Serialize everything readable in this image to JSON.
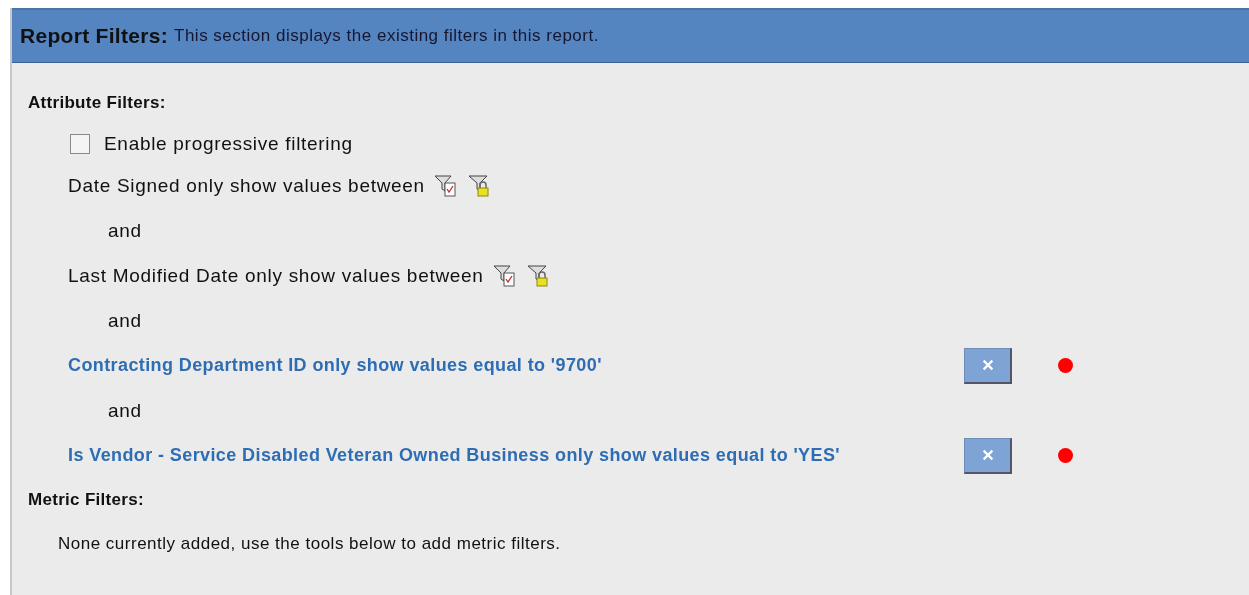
{
  "header": {
    "title": "Report Filters:",
    "description": "This section displays the existing filters in this report."
  },
  "attribute_filters": {
    "heading": "Attribute Filters:",
    "progressive": {
      "label": "Enable progressive filtering",
      "checked": false
    },
    "items": [
      {
        "kind": "range",
        "text": "Date Signed only show values between"
      },
      {
        "kind": "conjunction",
        "text": "and"
      },
      {
        "kind": "range",
        "text": "Last Modified Date only show values between"
      },
      {
        "kind": "conjunction",
        "text": "and"
      },
      {
        "kind": "equal",
        "text": "Contracting Department ID only show values equal to '9700'",
        "color": "#ff0000"
      },
      {
        "kind": "conjunction",
        "text": "and"
      },
      {
        "kind": "equal",
        "text": "Is Vendor - Service Disabled Veteran Owned Business only show values equal to 'YES'",
        "color": "#ff0000"
      }
    ]
  },
  "metric_filters": {
    "heading": "Metric Filters:",
    "message": "None currently added, use the tools below to add metric filters."
  }
}
